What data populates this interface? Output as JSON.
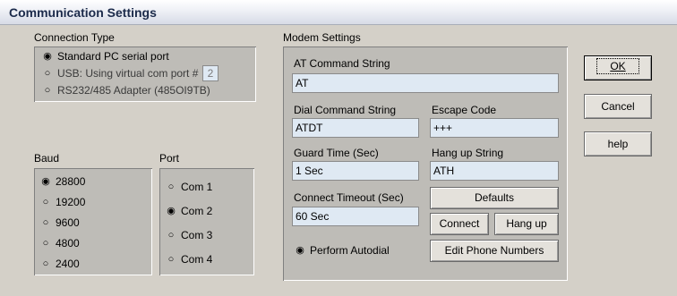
{
  "window": {
    "title": "Communication Settings"
  },
  "connection": {
    "heading": "Connection Type",
    "options": [
      {
        "label": "Standard PC serial port",
        "selected": true
      },
      {
        "label": "USB: Using virtual com port #",
        "selected": false
      },
      {
        "label": "RS232/485 Adapter (485OI9TB)",
        "selected": false
      }
    ],
    "usb_port_value": "2"
  },
  "baud": {
    "heading": "Baud",
    "options": [
      {
        "label": "28800",
        "selected": true
      },
      {
        "label": "19200",
        "selected": false
      },
      {
        "label": "9600",
        "selected": false
      },
      {
        "label": "4800",
        "selected": false
      },
      {
        "label": "2400",
        "selected": false
      }
    ]
  },
  "port": {
    "heading": "Port",
    "options": [
      {
        "label": "Com 1",
        "selected": false
      },
      {
        "label": "Com 2",
        "selected": true
      },
      {
        "label": "Com 3",
        "selected": false
      },
      {
        "label": "Com 4",
        "selected": false
      }
    ]
  },
  "modem": {
    "heading": "Modem Settings",
    "at_command_label": "AT Command String",
    "at_command_value": "AT",
    "dial_command_label": "Dial Command String",
    "dial_command_value": "ATDT",
    "escape_code_label": "Escape Code",
    "escape_code_value": "+++",
    "guard_time_label": "Guard Time (Sec)",
    "guard_time_value": "1 Sec",
    "hangup_string_label": "Hang up String",
    "hangup_string_value": "ATH",
    "connect_timeout_label": "Connect Timeout (Sec)",
    "connect_timeout_value": "60 Sec",
    "defaults_label": "Defaults",
    "connect_label": "Connect",
    "hangup_label": "Hang up",
    "autodial_label": "Perform Autodial",
    "autodial_selected": true,
    "edit_phone_label": "Edit Phone Numbers"
  },
  "buttons": {
    "ok_label": "OK",
    "cancel_label": "Cancel",
    "help_label": "help"
  }
}
